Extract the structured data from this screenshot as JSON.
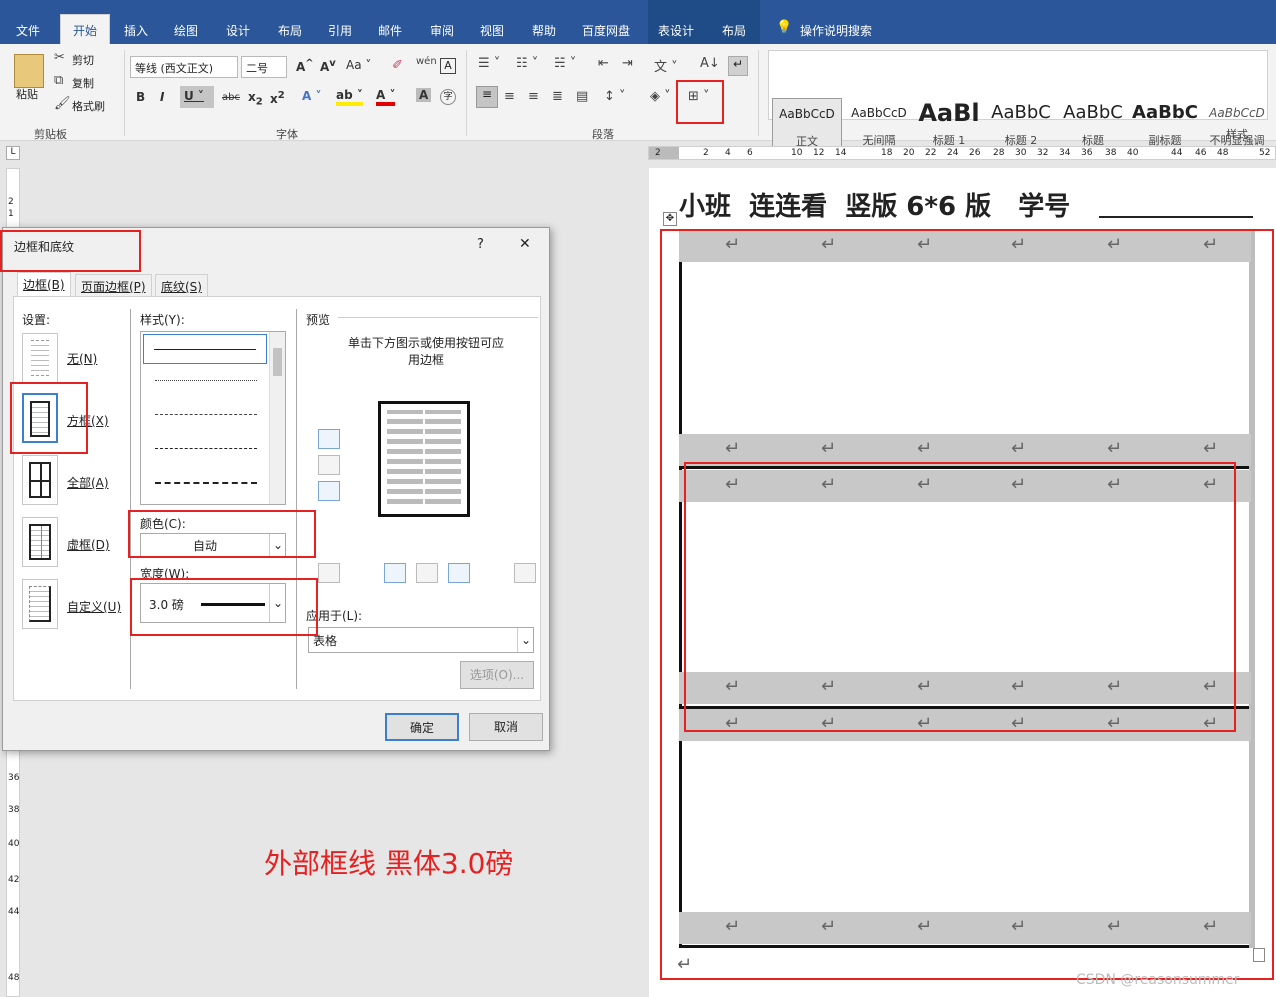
{
  "ribbon": {
    "tabs": [
      "文件",
      "开始",
      "插入",
      "绘图",
      "设计",
      "布局",
      "引用",
      "邮件",
      "审阅",
      "视图",
      "帮助",
      "百度网盘",
      "表设计",
      "布局"
    ],
    "tell_me": "操作说明搜索",
    "clipboard": {
      "paste": "粘贴",
      "cut": "剪切",
      "copy": "复制",
      "format_painter": "格式刷",
      "group": "剪贴板"
    },
    "font": {
      "name": "等线 (西文正文)",
      "size": "二号",
      "group": "字体"
    },
    "paragraph": {
      "group": "段落"
    },
    "styles": {
      "group": "样式",
      "items": [
        {
          "preview": "AaBbCcD",
          "name": "正文"
        },
        {
          "preview": "AaBbCcD",
          "name": "无间隔"
        },
        {
          "preview": "AaBl",
          "name": "标题 1"
        },
        {
          "preview": "AaBbC",
          "name": "标题 2"
        },
        {
          "preview": "AaBbC",
          "name": "标题"
        },
        {
          "preview": "AaBbC",
          "name": "副标题"
        },
        {
          "preview": "AaBbCcD",
          "name": "不明显强调"
        }
      ]
    }
  },
  "ruler": {
    "h": [
      "2",
      "2",
      "4",
      "6",
      "10",
      "12",
      "14",
      "18",
      "20",
      "22",
      "24",
      "26",
      "28",
      "30",
      "32",
      "34",
      "36",
      "38",
      "40",
      "44",
      "46",
      "48",
      "52"
    ],
    "v": [
      "2",
      "1",
      "36",
      "38",
      "40",
      "42",
      "44",
      "48"
    ]
  },
  "dialog": {
    "title": "边框和底纹",
    "help": "?",
    "close": "✕",
    "tabs": [
      "边框(B)",
      "页面边框(P)",
      "底纹(S)"
    ],
    "settings_label": "设置:",
    "presets": [
      "无(N)",
      "方框(X)",
      "全部(A)",
      "虚框(D)",
      "自定义(U)"
    ],
    "style_label": "样式(Y):",
    "color_label": "颜色(C):",
    "color_value": "自动",
    "width_label": "宽度(W):",
    "width_value": "3.0 磅",
    "preview_label": "预览",
    "preview_hint": "单击下方图示或使用按钮可应用边框",
    "apply_label": "应用于(L):",
    "apply_value": "表格",
    "options": "选项(O)...",
    "ok": "确定",
    "cancel": "取消"
  },
  "annotation": "外部框线 黑体3.0磅",
  "document": {
    "title": "小班  连连看  竖版 6*6 版   学号",
    "return_mark": "↵"
  },
  "watermark": "CSDN @reasonsummer",
  "colors": {
    "accent": "#2b579a",
    "highlight": "#e52121"
  }
}
